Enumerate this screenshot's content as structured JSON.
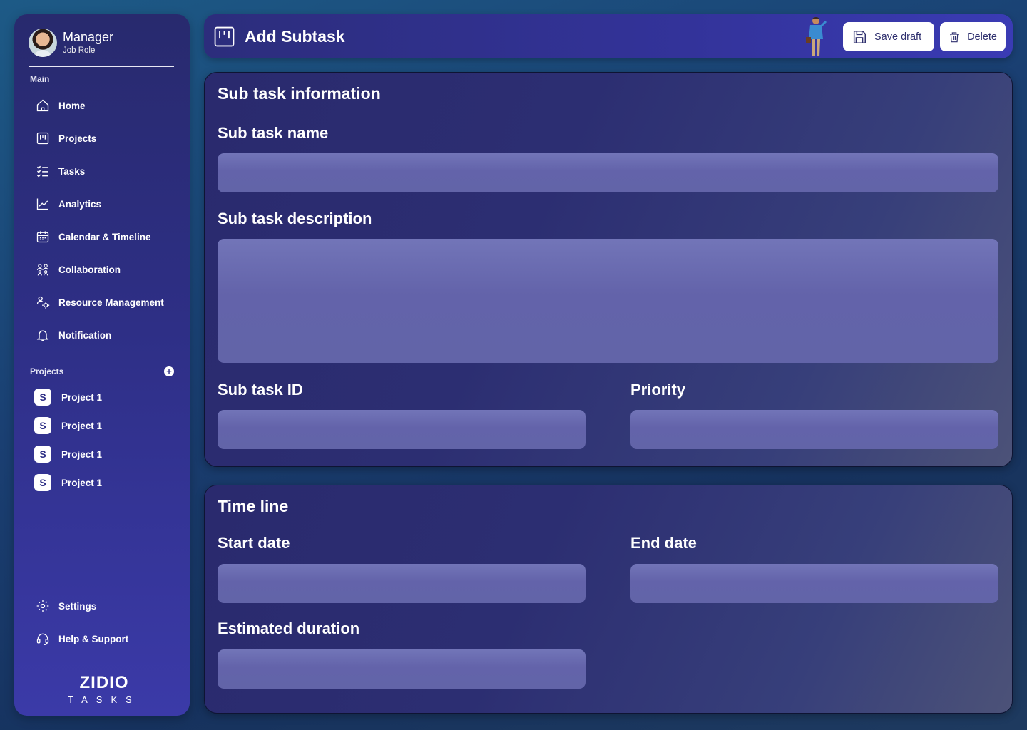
{
  "user": {
    "name": "Manager",
    "role": "Job Role"
  },
  "sidebar": {
    "main_label": "Main",
    "items": [
      {
        "label": "Home",
        "icon": "home-icon"
      },
      {
        "label": "Projects",
        "icon": "kanban-icon"
      },
      {
        "label": "Tasks",
        "icon": "task-list-icon"
      },
      {
        "label": "Analytics",
        "icon": "chart-icon"
      },
      {
        "label": "Calendar & Timeline",
        "icon": "calendar-icon"
      },
      {
        "label": "Collaboration",
        "icon": "people-icon"
      },
      {
        "label": "Resource Management",
        "icon": "resource-icon"
      },
      {
        "label": "Notification",
        "icon": "bell-icon"
      }
    ],
    "projects_label": "Projects",
    "projects": [
      {
        "label": "Project 1"
      },
      {
        "label": "Project 1"
      },
      {
        "label": "Project 1"
      },
      {
        "label": "Project 1"
      }
    ],
    "bottom_items": [
      {
        "label": "Settings",
        "icon": "gear-icon"
      },
      {
        "label": "Help & Support",
        "icon": "headset-icon"
      }
    ],
    "logo": {
      "main": "ZIDIO",
      "sub": "TASKS"
    }
  },
  "header": {
    "title": "Add Subtask",
    "save_draft_label": "Save draft",
    "delete_label": "Delete"
  },
  "subtask_info": {
    "title": "Sub task information",
    "name_label": "Sub task name",
    "name_value": "",
    "description_label": "Sub task description",
    "description_value": "",
    "id_label": "Sub task ID",
    "id_value": "",
    "priority_label": "Priority",
    "priority_value": ""
  },
  "timeline": {
    "title": "Time line",
    "start_label": "Start date",
    "start_value": "",
    "end_label": "End date",
    "end_value": "",
    "duration_label": "Estimated duration",
    "duration_value": ""
  },
  "colors": {
    "sidebar_top": "#282a6e",
    "sidebar_bottom": "#3b3aa8",
    "field": "#6563aa",
    "button_text": "#2e2f6e"
  }
}
